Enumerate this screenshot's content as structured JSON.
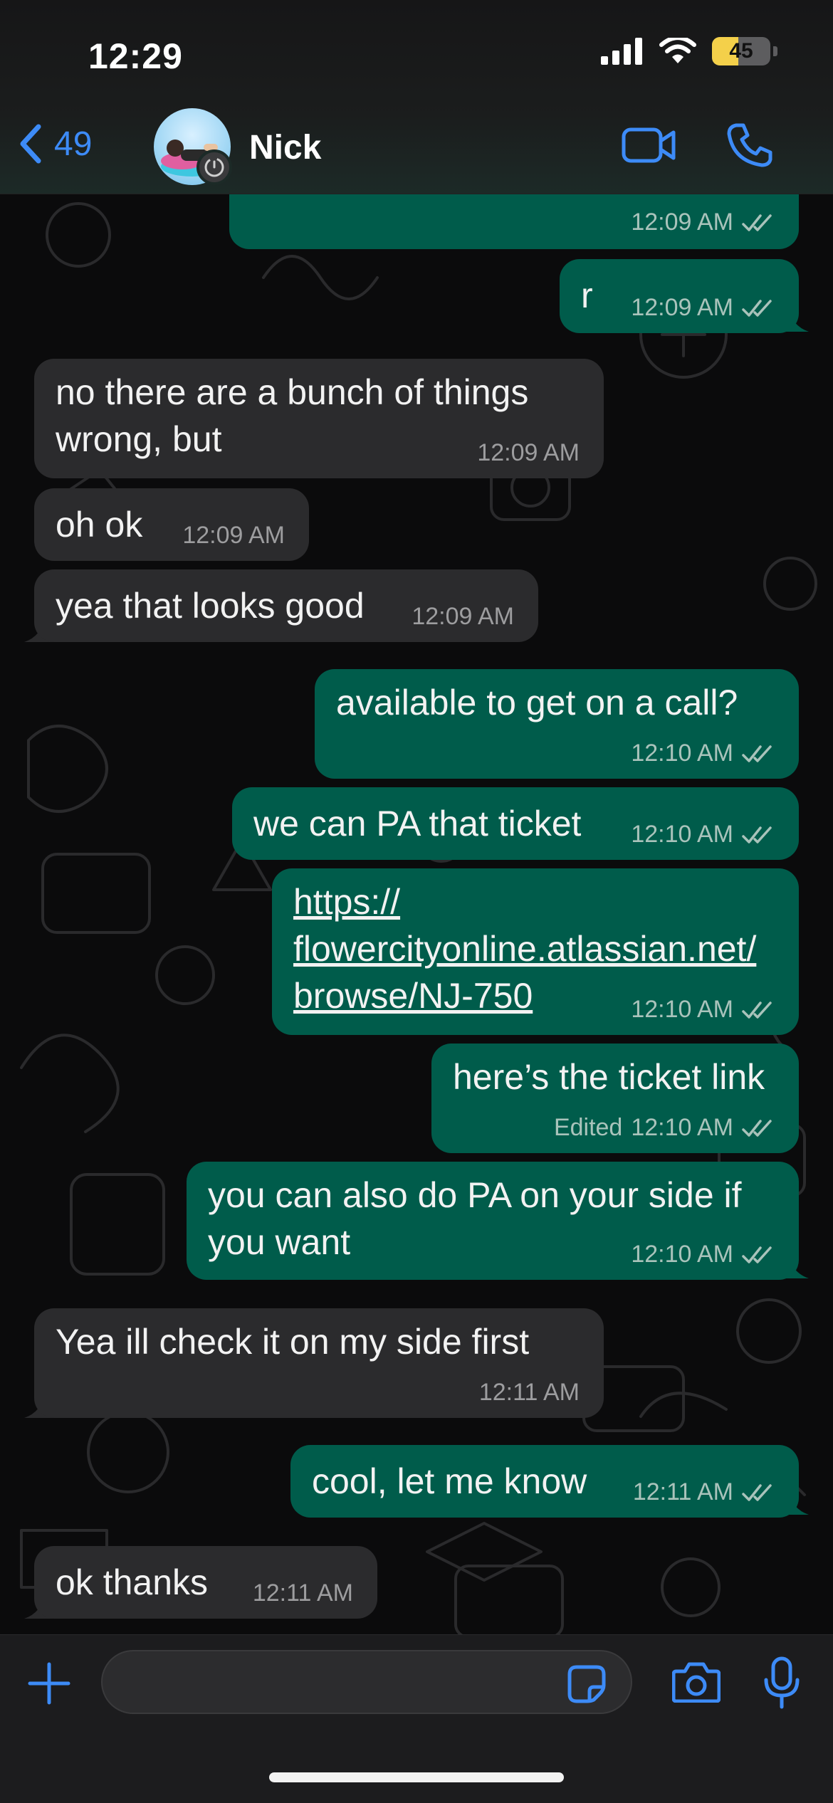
{
  "status_bar": {
    "time": "12:29",
    "battery": "45",
    "icons": [
      "signal-icon",
      "wifi-icon",
      "battery-icon"
    ]
  },
  "header": {
    "back_count": "49",
    "contact_name": "Nick",
    "icons": [
      "back-chevron-icon",
      "video-call-icon",
      "phone-call-icon"
    ]
  },
  "messages": [
    {
      "direction": "out",
      "text": "",
      "time": "12:09 AM",
      "status": "read"
    },
    {
      "direction": "out",
      "text": "r",
      "time": "12:09 AM",
      "status": "read"
    },
    {
      "direction": "in",
      "text": "no there are a bunch of things\nwrong, but",
      "time": "12:09 AM"
    },
    {
      "direction": "in",
      "text": "oh ok",
      "time": "12:09 AM"
    },
    {
      "direction": "in",
      "text": "yea that looks good",
      "time": "12:09 AM"
    },
    {
      "direction": "out",
      "text": "available to get on a call?",
      "time": "12:10 AM",
      "status": "read"
    },
    {
      "direction": "out",
      "text": "we can PA that ticket",
      "time": "12:10 AM",
      "status": "read"
    },
    {
      "direction": "out",
      "text": "https://\nflowercityonline.atlassian.net/\nbrowse/NJ-750",
      "time": "12:10 AM",
      "status": "read",
      "is_link": true
    },
    {
      "direction": "out",
      "text": "here’s the ticket link",
      "time": "12:10 AM",
      "edited_label": "Edited",
      "status": "read"
    },
    {
      "direction": "out",
      "text": "you can also do PA on your side if\nyou want",
      "time": "12:10 AM",
      "status": "read"
    },
    {
      "direction": "in",
      "text": "Yea ill check it on my side first",
      "time": "12:11 AM"
    },
    {
      "direction": "out",
      "text": "cool, let me know",
      "time": "12:11 AM",
      "status": "read"
    },
    {
      "direction": "in",
      "text": "ok thanks",
      "time": "12:11 AM"
    }
  ],
  "composer": {
    "placeholder": "",
    "icons": [
      "plus-icon",
      "sticker-icon",
      "camera-icon",
      "microphone-icon"
    ]
  },
  "colors": {
    "accent": "#3d8bf7",
    "outgoing_bubble": "#005c4b",
    "incoming_bubble": "#2b2b2d",
    "link": "#4aa3f5",
    "battery_fill": "#f4d04a"
  }
}
